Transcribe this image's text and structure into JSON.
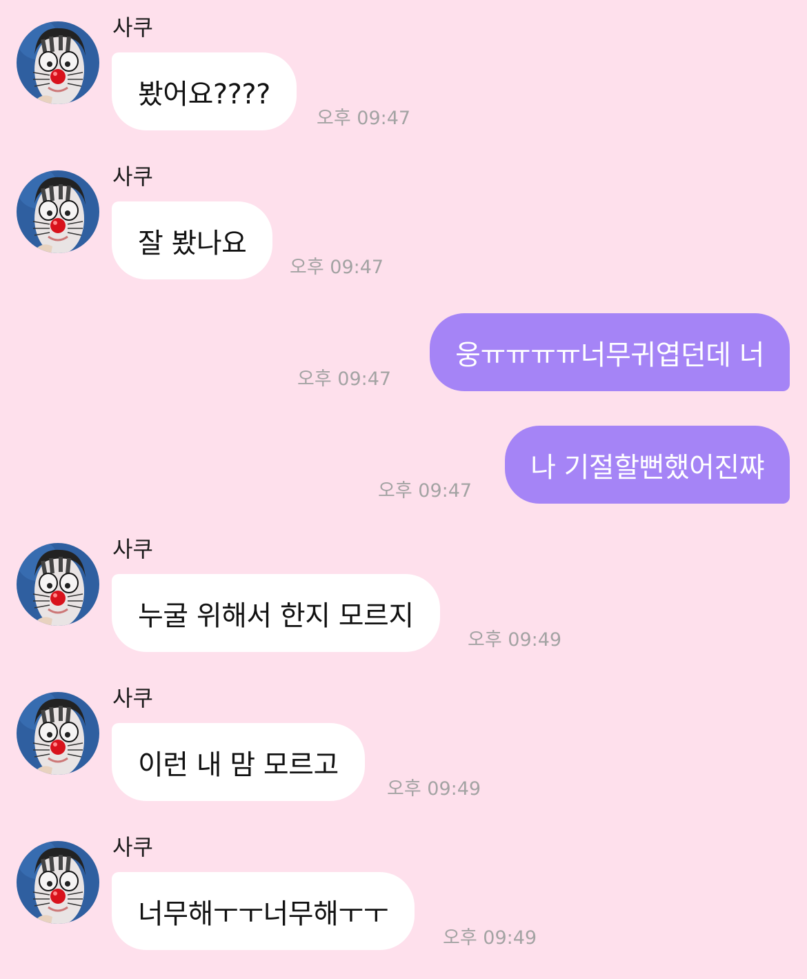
{
  "theme": {
    "background": "#fee0ec",
    "incoming_bubble": "#ffffff",
    "outgoing_bubble": "#a584f6",
    "time_color": "#a3a3a3"
  },
  "messages": [
    {
      "sender": "사쿠",
      "text": "봤어요????",
      "time": "오후 09:47",
      "direction": "incoming",
      "avatar": "clown-nose-avatar"
    },
    {
      "sender": "사쿠",
      "text": "잘 봤나요",
      "time": "오후 09:47",
      "direction": "incoming",
      "avatar": "clown-nose-avatar"
    },
    {
      "text": "웅ㅠㅠㅠㅠ너무귀엽던데 너",
      "time": "오후 09:47",
      "direction": "outgoing"
    },
    {
      "text": "나 기절할뻔했어진쨔",
      "time": "오후 09:47",
      "direction": "outgoing"
    },
    {
      "sender": "사쿠",
      "text": "누굴 위해서 한지 모르지",
      "time": "오후 09:49",
      "direction": "incoming",
      "avatar": "clown-nose-avatar"
    },
    {
      "sender": "사쿠",
      "text": "이런 내 맘 모르고",
      "time": "오후 09:49",
      "direction": "incoming",
      "avatar": "clown-nose-avatar"
    },
    {
      "sender": "사쿠",
      "text": "너무해ㅜㅜ너무해ㅜㅜ",
      "time": "오후 09:49",
      "direction": "incoming",
      "avatar": "clown-nose-avatar"
    }
  ]
}
